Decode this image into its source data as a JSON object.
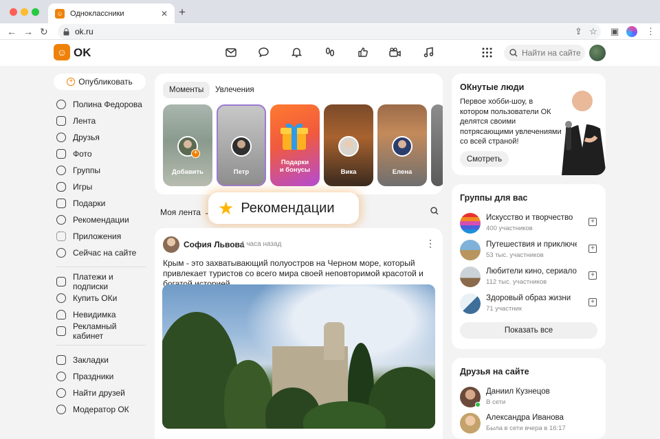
{
  "browser": {
    "tab_title": "Одноклассники",
    "url": "ok.ru"
  },
  "header": {
    "brand": "OK",
    "search_placeholder": "Найти на сайте",
    "icons": [
      "mail-icon",
      "chat-icon",
      "bell-icon",
      "guests-icon",
      "likes-icon",
      "video-icon",
      "music-icon",
      "apps-icon"
    ]
  },
  "sidebar": {
    "publish_label": "Опубликовать",
    "group1": [
      {
        "label": "Полина Федорова",
        "icon": "profile-icon"
      },
      {
        "label": "Лента",
        "icon": "home-icon"
      },
      {
        "label": "Друзья",
        "icon": "friends-icon"
      },
      {
        "label": "Фото",
        "icon": "photo-icon"
      },
      {
        "label": "Группы",
        "icon": "groups-icon"
      },
      {
        "label": "Игры",
        "icon": "games-icon"
      },
      {
        "label": "Подарки",
        "icon": "gift-icon"
      },
      {
        "label": "Рекомендации",
        "icon": "compass-icon"
      },
      {
        "label": "Приложения",
        "icon": "apps-icon"
      },
      {
        "label": "Сейчас на сайте",
        "icon": "online-icon"
      }
    ],
    "group2": [
      {
        "label": "Платежи и подписки",
        "icon": "card-icon"
      },
      {
        "label": "Купить ОКи",
        "icon": "coin-icon"
      },
      {
        "label": "Невидимка",
        "icon": "invisible-icon"
      },
      {
        "label": "Рекламный кабинет",
        "icon": "megaphone-icon"
      }
    ],
    "group3": [
      {
        "label": "Закладки",
        "icon": "bookmark-icon"
      },
      {
        "label": "Праздники",
        "icon": "party-icon"
      },
      {
        "label": "Найти друзей",
        "icon": "find-friends-icon"
      },
      {
        "label": "Модератор ОК",
        "icon": "moderator-icon"
      }
    ]
  },
  "moments": {
    "tabs": [
      "Моменты",
      "Увлечения"
    ],
    "stories": [
      {
        "label": "Добавить"
      },
      {
        "label": "Петр"
      },
      {
        "label": "Подарки\nи бонусы"
      },
      {
        "label": "Вика"
      },
      {
        "label": "Елена"
      }
    ]
  },
  "feed": {
    "selector": "Моя лента",
    "recommendations_label": "Рекомендации"
  },
  "post": {
    "author": "София Львова",
    "time": "4 часа назад",
    "text": "Крым - это захватывающий полуостров на Черном море, который привлекает туристов со всего мира своей неповторимой красотой и богатой историей"
  },
  "oknutye": {
    "title": "ОКнутые люди",
    "description": "Первое хобби-шоу, в котором пользователи ОК делятся своими потрясающими увлечениями со всей страной!",
    "button": "Смотреть"
  },
  "groups": {
    "title": "Группы для вас",
    "items": [
      {
        "name": "Искусство и творчество",
        "members": "400 участников"
      },
      {
        "name": "Путешествия и приключения",
        "members": "53 тыс. участников"
      },
      {
        "name": "Любители кино, сериалов",
        "members": "112 тыс. участников"
      },
      {
        "name": "Здоровый образ жизни",
        "members": "71 участник"
      }
    ],
    "show_all": "Показать все"
  },
  "friends": {
    "title": "Друзья на сайте",
    "items": [
      {
        "name": "Даниил Кузнецов",
        "status": "В сети"
      },
      {
        "name": "Александра Иванова",
        "status": "Была в сети вчера в 16:17"
      }
    ]
  },
  "colors": {
    "accent": "#ee8208",
    "page_bg": "#f3f3f3"
  }
}
